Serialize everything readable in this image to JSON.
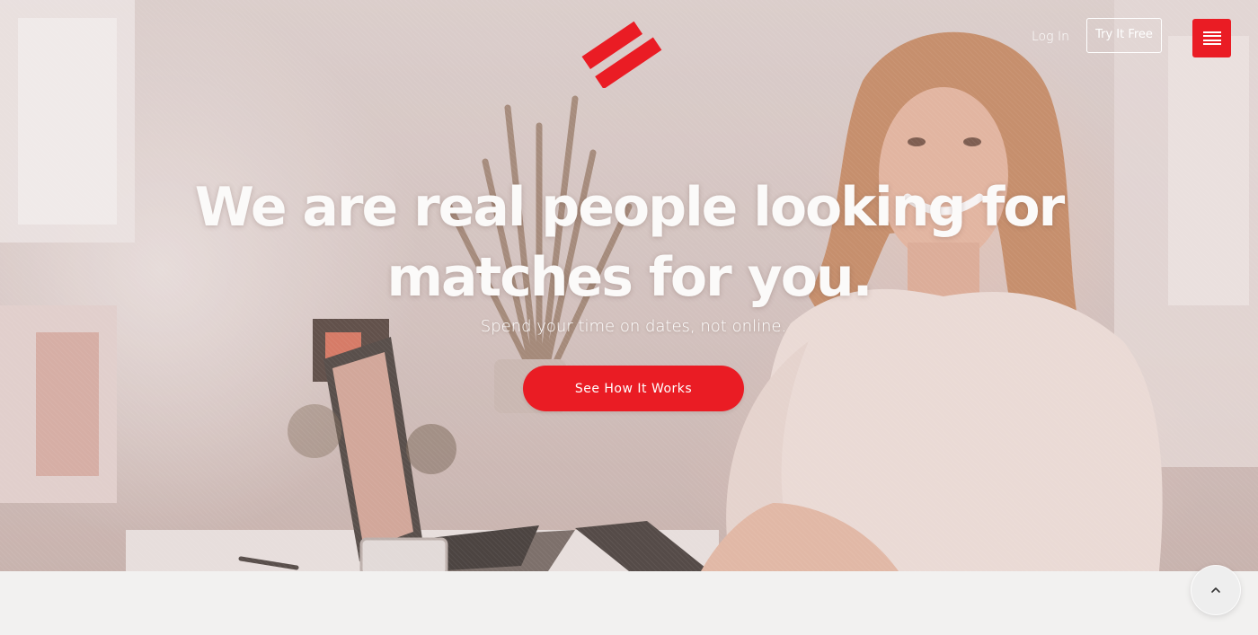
{
  "brand": {
    "logo_icon": "double-stripe-logo-icon",
    "accent_color": "#ea1c24"
  },
  "nav": {
    "login_label": "Log In",
    "try_label": "Try It Free",
    "menu_icon": "hamburger-menu-icon"
  },
  "hero": {
    "headline": "We are real people looking for matches for you.",
    "subheadline": "Spend your time on dates, not online.",
    "cta_label": "See How It Works"
  },
  "back_to_top": {
    "icon": "chevron-up-icon"
  }
}
